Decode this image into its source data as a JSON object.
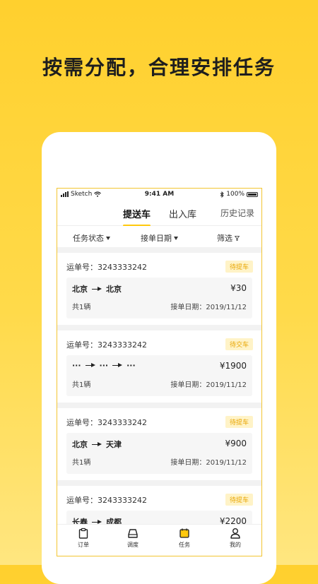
{
  "headline": "按需分配，合理安排任务",
  "status_bar": {
    "carrier": "Sketch",
    "time": "9:41 AM",
    "battery": "100%"
  },
  "tabs": [
    {
      "label": "提送车",
      "active": true
    },
    {
      "label": "出入库",
      "active": false
    },
    {
      "label": "历史记录",
      "active": false
    }
  ],
  "filters": {
    "status_label": "任务状态",
    "date_label": "接单日期",
    "screen_label": "筛选"
  },
  "orders": [
    {
      "order_label": "运单号：3243333242",
      "badge": "待提车",
      "from": "北京",
      "to": "北京",
      "price": "¥30",
      "count": "共1辆",
      "date": "接单日期：2019/11/12"
    },
    {
      "order_label": "运单号：3243333242",
      "badge": "待交车",
      "from": "···",
      "via": "···",
      "to": "···",
      "price": "¥1900",
      "count": "共1辆",
      "date": "接单日期：2019/11/12"
    },
    {
      "order_label": "运单号：3243333242",
      "badge": "待提车",
      "from": "北京",
      "to": "天津",
      "price": "¥900",
      "count": "共1辆",
      "date": "接单日期：2019/11/12"
    },
    {
      "order_label": "运单号：3243333242",
      "badge": "待提车",
      "from": "长春",
      "to": "成都",
      "price": "¥2200"
    }
  ],
  "bottom_nav": [
    {
      "label": "订单",
      "icon": "clipboard-icon"
    },
    {
      "label": "调度",
      "icon": "car-icon"
    },
    {
      "label": "任务",
      "icon": "calendar-icon",
      "active": true
    },
    {
      "label": "我的",
      "icon": "person-icon"
    }
  ],
  "colors": {
    "brand_yellow": "#FFC90E",
    "badge_bg": "#FFF3C7",
    "badge_text": "#E8A500"
  }
}
